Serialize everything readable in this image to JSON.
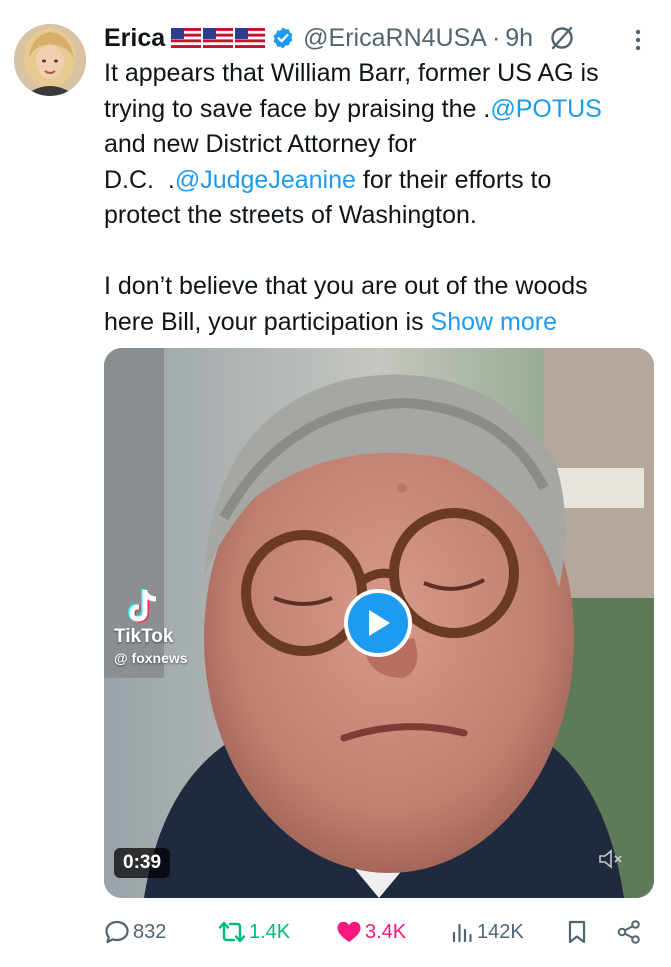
{
  "author": {
    "name": "Erica",
    "flags": [
      "us-flag",
      "us-flag",
      "us-flag"
    ],
    "verified_icon": "verified-badge-icon",
    "handle": "@EricaRN4USA",
    "separator": "·",
    "time": "9h"
  },
  "post": {
    "lines": [
      [
        "It appears that William Barr, former US AG is"
      ],
      [
        "trying to save face by praising the .",
        "@POTUS"
      ],
      [
        "and new District Attorney for"
      ],
      [
        "D.C.  .",
        "@JudgeJeanine",
        " for their efforts to"
      ],
      [
        "protect the streets of Washington."
      ],
      [
        "I don’t believe that you are out of the woods"
      ],
      [
        "here Bill, your participation is ",
        "Show more"
      ]
    ],
    "line1": "It appears that William Barr, former US AG is",
    "line2_a": "trying to save face by praising the .",
    "line2_mention": "@POTUS",
    "line3": "and new District Attorney for",
    "line4_a": "D.C.  .",
    "line4_mention": "@JudgeJeanine",
    "line4_b": " for their efforts to",
    "line5": "protect the streets of Washington.",
    "line6": "I don’t believe that you are out of the woods",
    "line7_a": "here Bill, your participation is ",
    "show_more": "Show more"
  },
  "media": {
    "watermark_brand": "TikTok",
    "watermark_user": "@ foxnews",
    "duration": "0:39",
    "play_icon": "play-icon",
    "mute_icon": "muted-speaker-icon"
  },
  "actions": {
    "replies": "832",
    "reposts": "1.4K",
    "likes": "3.4K",
    "views": "142K"
  },
  "colors": {
    "link": "#1d9bf0",
    "repost": "#00ba7c",
    "like": "#f91880",
    "muted_text": "#536471",
    "text": "#0f1419"
  }
}
